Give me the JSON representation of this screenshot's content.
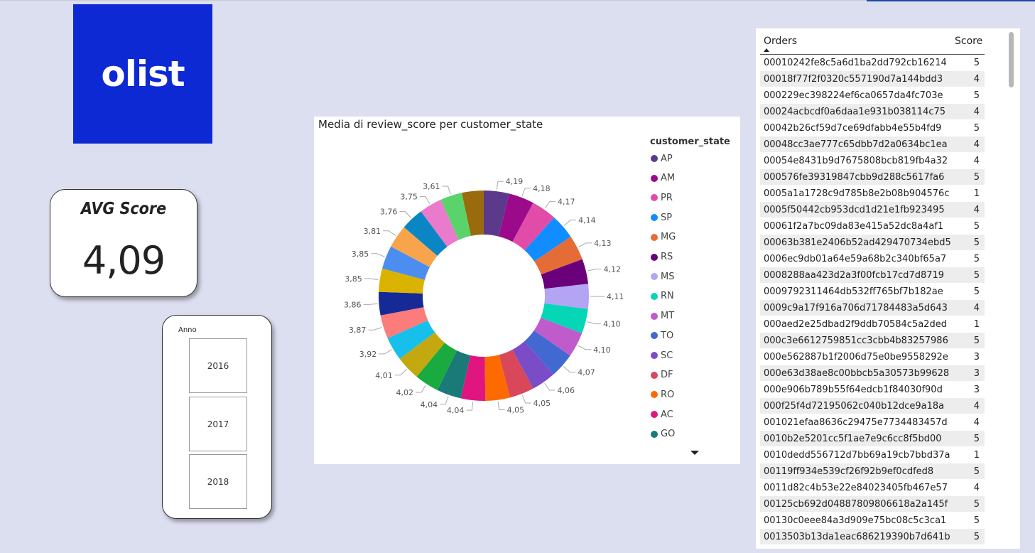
{
  "logo": {
    "text": "olist",
    "color": "#0c29d3"
  },
  "kpi_card": {
    "title": "AVG Score",
    "value": "4,09"
  },
  "slicer": {
    "title": "Anno",
    "items": [
      "2016",
      "2017",
      "2018"
    ]
  },
  "chart": {
    "title": "Media di review_score per customer_state",
    "legend_title": "customer_state",
    "legend_more_icon": "triangle-down"
  },
  "chart_data": {
    "type": "donut",
    "title": "Media di review_score per customer_state",
    "legend_title": "customer_state",
    "legend_position": "right",
    "categories": [
      "AP",
      "AM",
      "PR",
      "SP",
      "MG",
      "RS",
      "MS",
      "RN",
      "MT",
      "TO",
      "SC",
      "DF",
      "RO",
      "AC",
      "GO",
      "",
      "",
      "",
      "",
      "",
      "",
      "",
      "",
      "",
      "",
      "",
      ""
    ],
    "values": [
      4.19,
      4.18,
      4.17,
      4.14,
      4.13,
      4.12,
      4.11,
      4.1,
      4.1,
      4.07,
      4.06,
      4.05,
      4.05,
      4.04,
      4.04,
      4.02,
      4.01,
      3.92,
      3.87,
      3.86,
      3.85,
      3.85,
      3.81,
      3.76,
      3.75,
      3.61
    ],
    "labels": [
      "4,19",
      "4,18",
      "4,17",
      "4,14",
      "4,13",
      "4,12",
      "4,11",
      "4,10",
      "4,10",
      "4,07",
      "4,06",
      "4,05",
      "4,05",
      "4,04",
      "4,04",
      "4,02",
      "4,01",
      "3,92",
      "3,87",
      "3,86",
      "3,85",
      "3,85",
      "3,81",
      "3,76",
      "3,75",
      "3,61"
    ],
    "colors": [
      "#5b3a8c",
      "#9b0a8a",
      "#e04ca8",
      "#118dff",
      "#e66c37",
      "#6b007b",
      "#b3a4f4",
      "#05d6b6",
      "#c05bcb",
      "#4269d0",
      "#7a4cc8",
      "#d9475a",
      "#fd6b00",
      "#e0157f",
      "#1a7a78",
      "#1aab40",
      "#c4a80f",
      "#17c0eb",
      "#fc7b7b",
      "#162a96",
      "#d9b300",
      "#4c8ef0",
      "#f7a44d",
      "#0a86c5",
      "#ea7acc",
      "#5ad46a",
      "#9a6b0c"
    ]
  },
  "table": {
    "header_orders": "Orders",
    "header_score": "Score",
    "rows": [
      {
        "order": "00010242fe8c5a6d1ba2dd792cb16214",
        "score": "5"
      },
      {
        "order": "00018f77f2f0320c557190d7a144bdd3",
        "score": "4"
      },
      {
        "order": "000229ec398224ef6ca0657da4fc703e",
        "score": "5"
      },
      {
        "order": "00024acbcdf0a6daa1e931b038114c75",
        "score": "4"
      },
      {
        "order": "00042b26cf59d7ce69dfabb4e55b4fd9",
        "score": "5"
      },
      {
        "order": "00048cc3ae777c65dbb7d2a0634bc1ea",
        "score": "4"
      },
      {
        "order": "00054e8431b9d7675808bcb819fb4a32",
        "score": "4"
      },
      {
        "order": "000576fe39319847cbb9d288c5617fa6",
        "score": "5"
      },
      {
        "order": "0005a1a1728c9d785b8e2b08b904576c",
        "score": "1"
      },
      {
        "order": "0005f50442cb953dcd1d21e1fb923495",
        "score": "4"
      },
      {
        "order": "00061f2a7bc09da83e415a52dc8a4af1",
        "score": "5"
      },
      {
        "order": "00063b381e2406b52ad429470734ebd5",
        "score": "5"
      },
      {
        "order": "0006ec9db01a64e59a68b2c340bf65a7",
        "score": "5"
      },
      {
        "order": "0008288aa423d2a3f00fcb17cd7d8719",
        "score": "5"
      },
      {
        "order": "0009792311464db532ff765bf7b182ae",
        "score": "5"
      },
      {
        "order": "0009c9a17f916a706d71784483a5d643",
        "score": "4"
      },
      {
        "order": "000aed2e25dbad2f9ddb70584c5a2ded",
        "score": "1"
      },
      {
        "order": "000c3e6612759851cc3cbb4b83257986",
        "score": "5"
      },
      {
        "order": "000e562887b1f2006d75e0be9558292e",
        "score": "3"
      },
      {
        "order": "000e63d38ae8c00bbcb5a30573b99628",
        "score": "3"
      },
      {
        "order": "000e906b789b55f64edcb1f84030f90d",
        "score": "3"
      },
      {
        "order": "000f25f4d72195062c040b12dce9a18a",
        "score": "4"
      },
      {
        "order": "001021efaa8636c29475e7734483457d",
        "score": "4"
      },
      {
        "order": "0010b2e5201cc5f1ae7e9c6cc8f5bd00",
        "score": "5"
      },
      {
        "order": "0010dedd556712d7bb69a19cb7bbd37a",
        "score": "1"
      },
      {
        "order": "00119ff934e539cf26f92b9ef0cdfed8",
        "score": "5"
      },
      {
        "order": "0011d82c4b53e22e84023405fb467e57",
        "score": "4"
      },
      {
        "order": "00125cb692d04887809806618a2a145f",
        "score": "5"
      },
      {
        "order": "00130c0eee84a3d909e75bc08c5c3ca1",
        "score": "5"
      },
      {
        "order": "0013503b13da1eac686219390b7d641b",
        "score": "5"
      }
    ]
  }
}
